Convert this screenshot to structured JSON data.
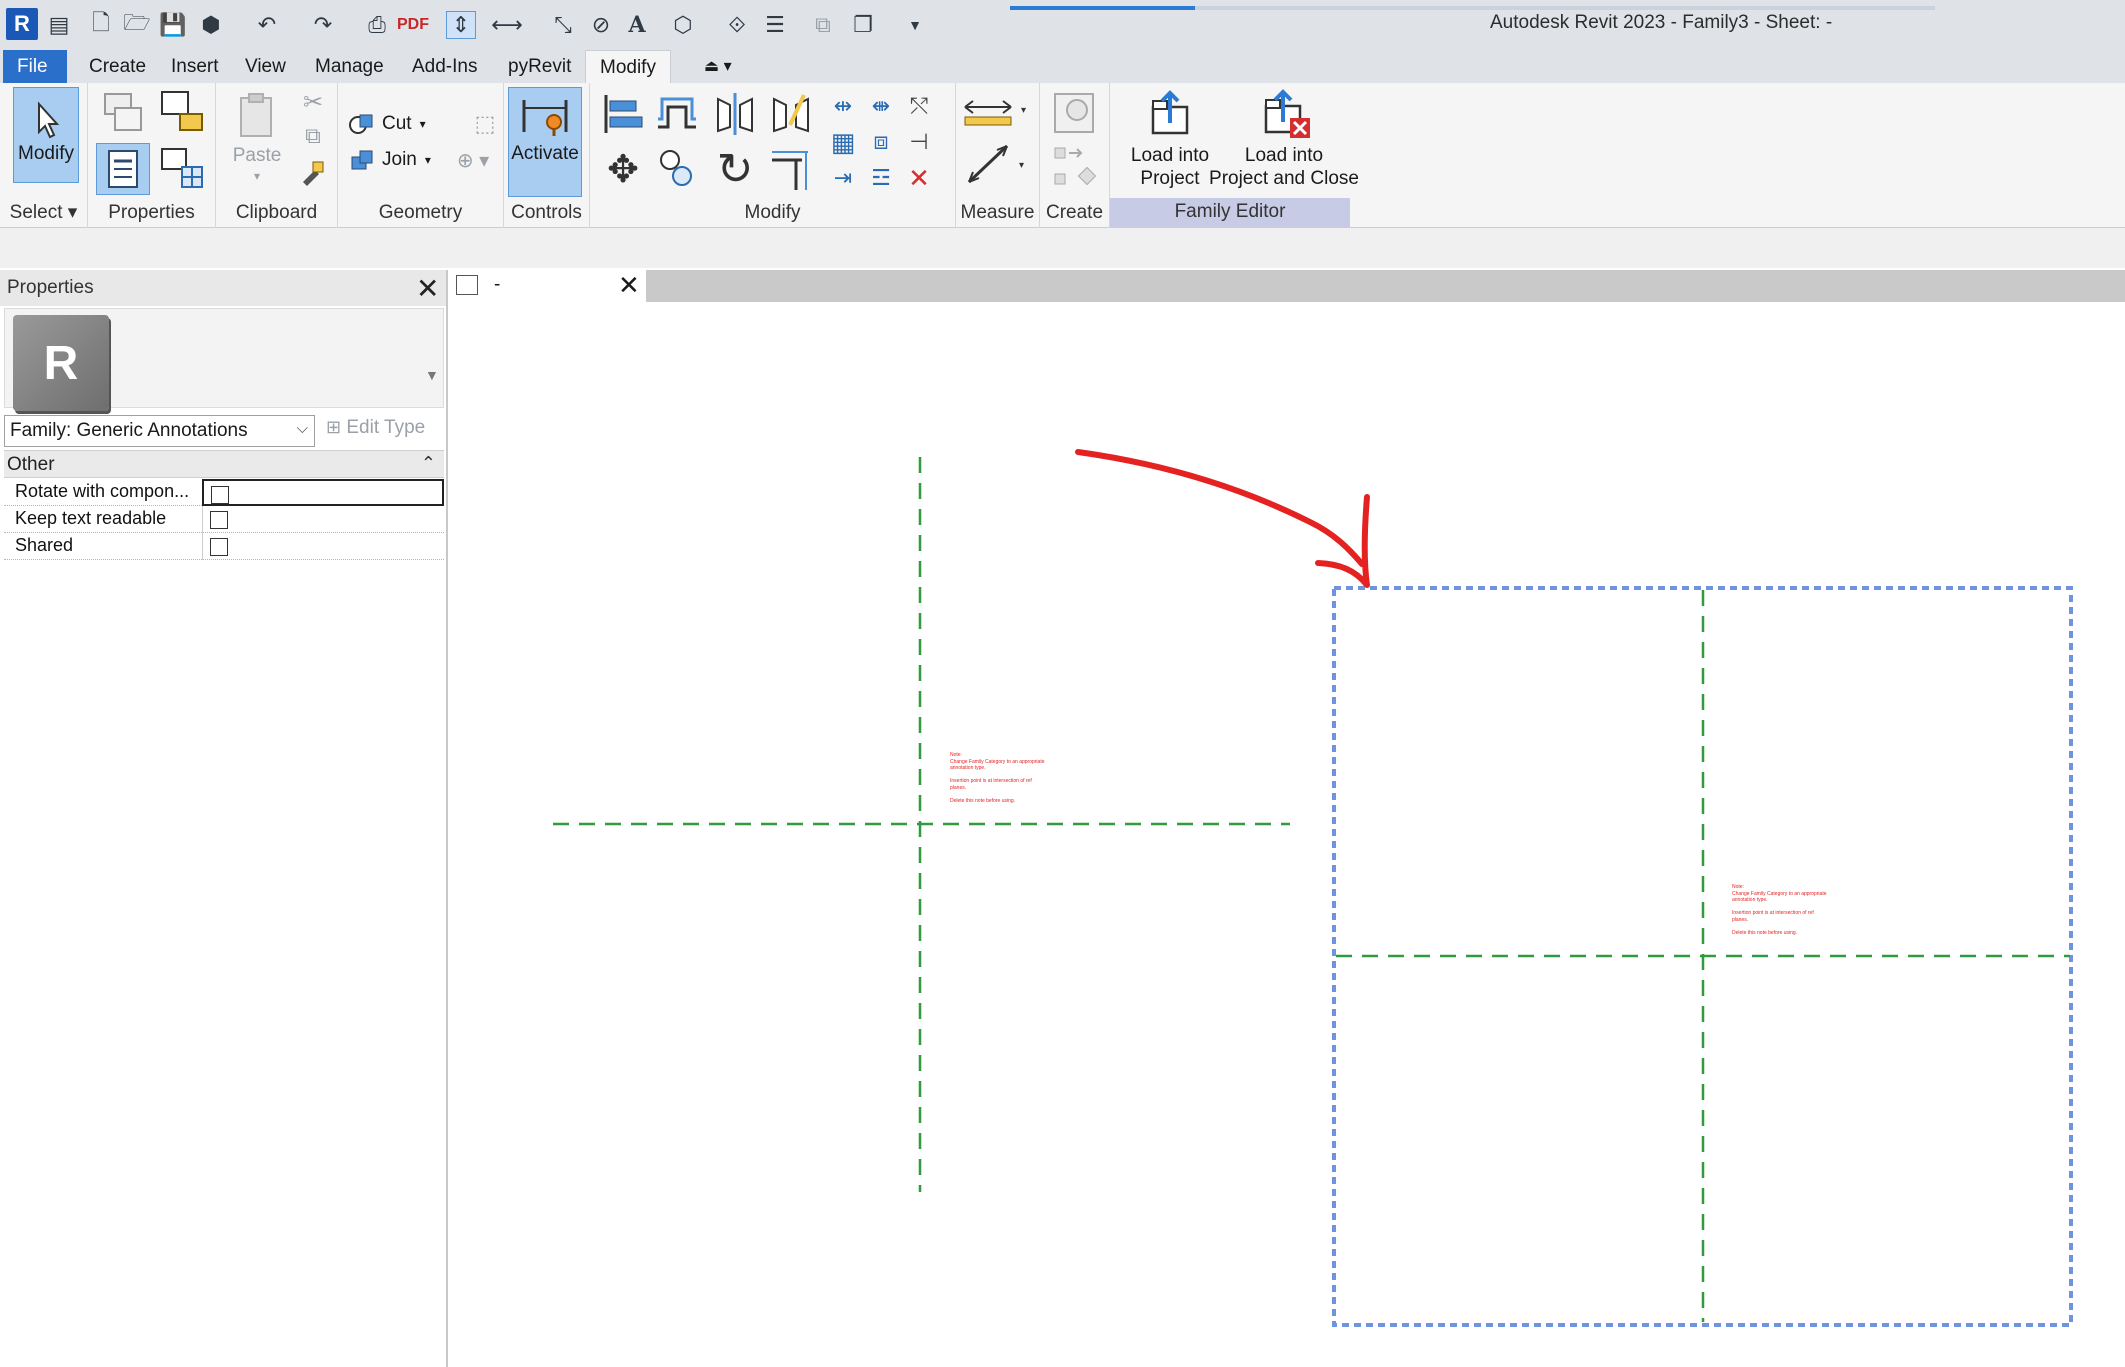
{
  "window": {
    "title": "Autodesk Revit 2023 - Family3 - Sheet: -"
  },
  "quick_access": {
    "icons": [
      "open-documents-icon",
      "new-icon",
      "open-icon",
      "save-icon",
      "sync-icon",
      "undo-icon",
      "redo-icon",
      "print-icon",
      "pdf-export-icon",
      "measure-icon",
      "aligned-dimension-icon",
      "align-icon",
      "tag-icon",
      "text-icon",
      "3d-view-icon",
      "section-icon",
      "thin-lines-icon",
      "close-hidden-icon",
      "switch-windows-icon",
      "customize-icon"
    ]
  },
  "tabs": [
    {
      "label": "File"
    },
    {
      "label": "Create"
    },
    {
      "label": "Insert"
    },
    {
      "label": "View"
    },
    {
      "label": "Manage"
    },
    {
      "label": "Add-Ins"
    },
    {
      "label": "pyRevit"
    },
    {
      "label": "Modify"
    }
  ],
  "ribbon": {
    "select": {
      "label": "Select",
      "modify_label": "Modify"
    },
    "properties": {
      "label": "Properties"
    },
    "clipboard": {
      "label": "Clipboard",
      "paste_label": "Paste"
    },
    "geometry": {
      "label": "Geometry",
      "cut_label": "Cut",
      "join_label": "Join"
    },
    "controls": {
      "label": "Controls",
      "activate_label": "Activate"
    },
    "modify": {
      "label": "Modify"
    },
    "measure": {
      "label": "Measure"
    },
    "create": {
      "label": "Create"
    },
    "family_editor": {
      "label": "Family Editor",
      "load_project_line1": "Load into",
      "load_project_line2": "Project",
      "load_close_line1": "Load into",
      "load_close_line2": "Project and Close"
    }
  },
  "properties_palette": {
    "title": "Properties",
    "type_letter": "R",
    "family_select": "Family: Generic Annotations",
    "edit_type_label": "Edit Type",
    "category": "Other",
    "rows": [
      {
        "name": "Rotate with compon...",
        "checked": false
      },
      {
        "name": "Keep text readable",
        "checked": false
      },
      {
        "name": "Shared",
        "checked": false
      }
    ]
  },
  "view": {
    "tab_name": "-",
    "note_lines": [
      "Note:",
      "Change Family Category to an appropriate",
      "annotation type.",
      "",
      "Insertion point is at intersection of ref",
      "planes.",
      "",
      "Delete this note before using."
    ]
  },
  "colors": {
    "accent": "#2a6fc9",
    "ref_plane": "#2f9a3f",
    "selection": "#6f93dd",
    "annotation_red": "#e52222"
  }
}
